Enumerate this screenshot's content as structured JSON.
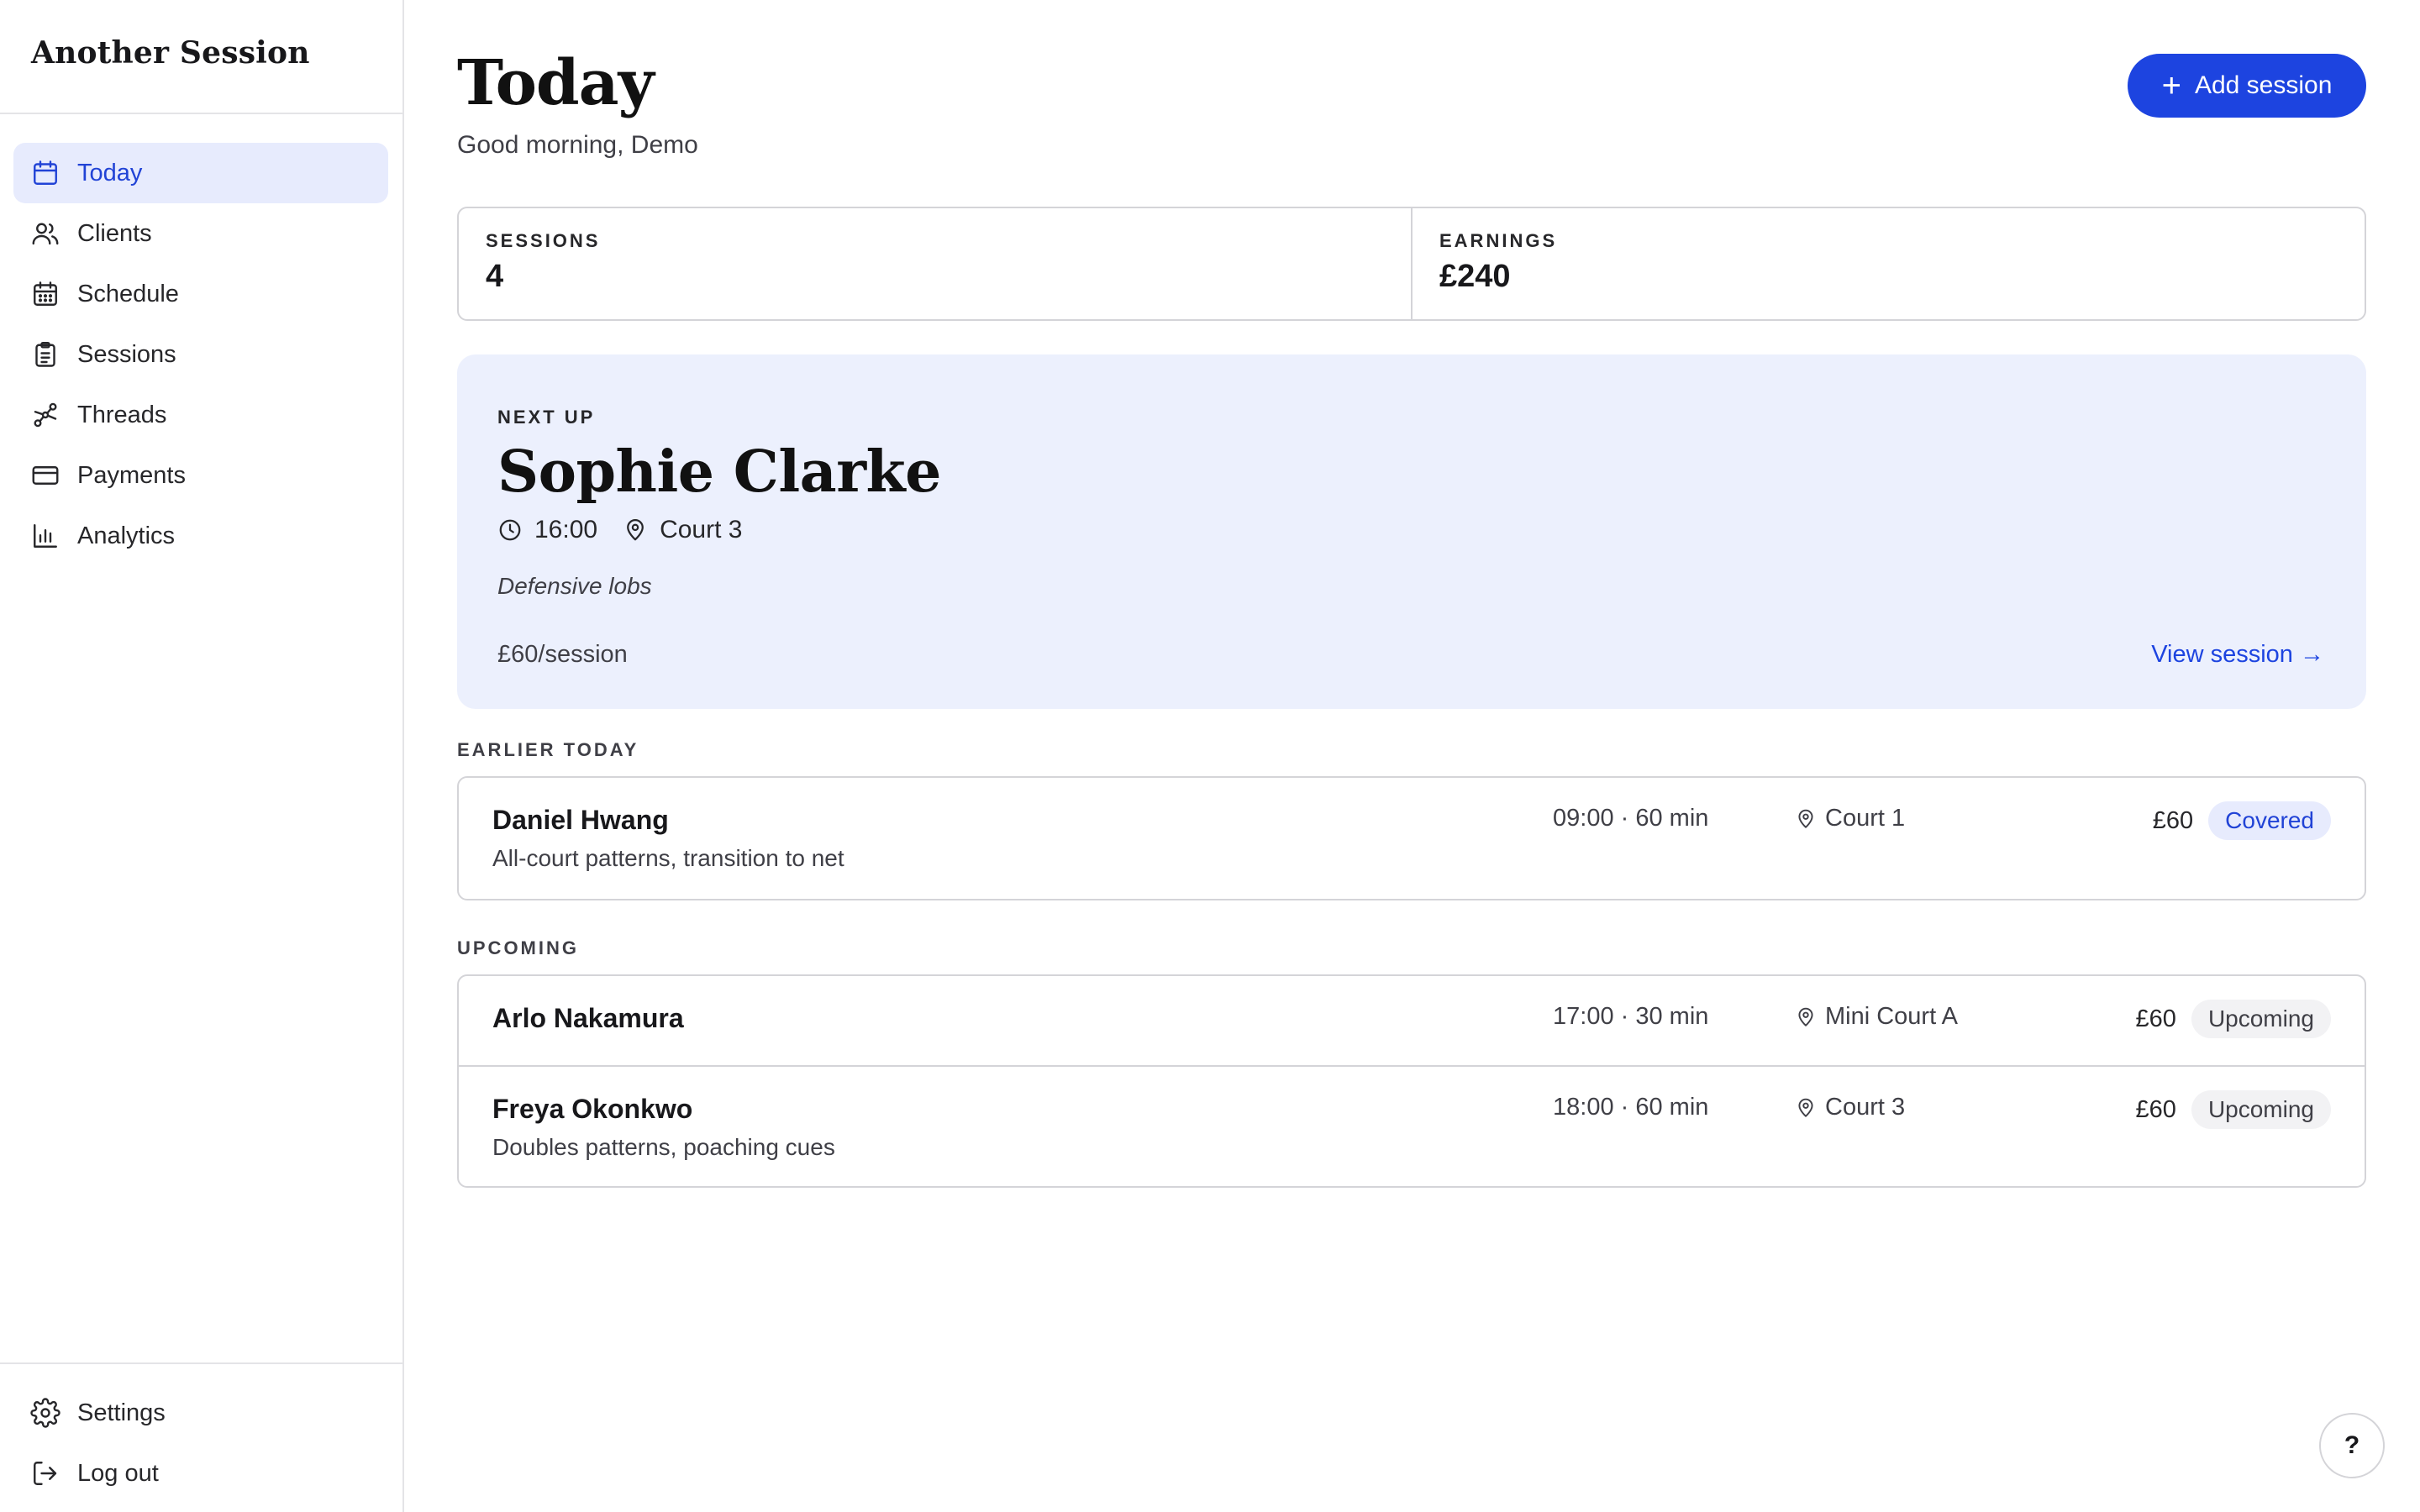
{
  "app": {
    "brand": "Another Session"
  },
  "sidebar": {
    "items": [
      {
        "label": "Today",
        "icon": "calendar-icon",
        "active": true
      },
      {
        "label": "Clients",
        "icon": "users-icon"
      },
      {
        "label": "Schedule",
        "icon": "calendar-grid-icon"
      },
      {
        "label": "Sessions",
        "icon": "clipboard-icon"
      },
      {
        "label": "Threads",
        "icon": "route-icon"
      },
      {
        "label": "Payments",
        "icon": "credit-card-icon"
      },
      {
        "label": "Analytics",
        "icon": "bar-chart-icon"
      }
    ],
    "bottom": [
      {
        "label": "Settings",
        "icon": "gear-icon"
      },
      {
        "label": "Log out",
        "icon": "logout-icon"
      }
    ]
  },
  "header": {
    "title": "Today",
    "greeting": "Good morning, Demo",
    "add_label": "Add session",
    "add_icon": "plus-icon"
  },
  "stats": [
    {
      "label": "SESSIONS",
      "value": "4"
    },
    {
      "label": "EARNINGS",
      "value": "£240"
    }
  ],
  "next_up": {
    "label": "NEXT UP",
    "name": "Sophie Clarke",
    "time": "16:00",
    "location": "Court 3",
    "focus": "Defensive lobs",
    "rate": "£60/session",
    "link_label": "View session →"
  },
  "earlier": {
    "label": "EARLIER TODAY",
    "rows": [
      {
        "name": "Daniel Hwang",
        "desc": "All-court patterns, transition to net",
        "time": "09:00 · 60 min",
        "location": "Court 1",
        "price": "£60",
        "status": "Covered"
      }
    ]
  },
  "upcoming": {
    "label": "UPCOMING",
    "rows": [
      {
        "name": "Arlo Nakamura",
        "desc": "",
        "time": "17:00 · 30 min",
        "location": "Mini Court A",
        "price": "£60",
        "status": "Upcoming"
      },
      {
        "name": "Freya Okonkwo",
        "desc": "Doubles patterns, poaching cues",
        "time": "18:00 · 60 min",
        "location": "Court 3",
        "price": "£60",
        "status": "Upcoming"
      }
    ]
  },
  "help": {
    "label": "?"
  },
  "colors": {
    "accent": "#1d44e0",
    "accent_soft": "#e7ebfd",
    "card_bg": "#ecf0fd",
    "border": "#d4d4d8"
  }
}
